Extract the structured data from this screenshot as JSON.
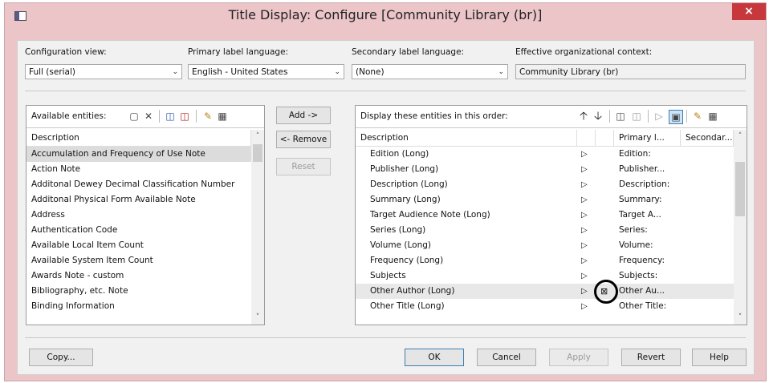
{
  "window": {
    "title": "Title Display: Configure [Community Library  (br)]",
    "close_glyph": "×",
    "accent_color": "#ecc5c9",
    "close_color": "#c7383c"
  },
  "config": {
    "configuration_view": {
      "label": "Configuration view:",
      "value": "Full (serial)"
    },
    "primary_language": {
      "label": "Primary label language:",
      "value": "English - United States"
    },
    "secondary_language": {
      "label": "Secondary label language:",
      "value": "(None)"
    },
    "context": {
      "label": "Effective organizational context:",
      "value": "Community Library  (br)"
    }
  },
  "available": {
    "toolbar_label": "Available entities:",
    "column_header": "Description",
    "items": [
      "Accumulation and Frequency of Use Note",
      "Action Note",
      "Additonal Dewey Decimal Classification Number",
      "Additonal Physical Form Available Note",
      "Address",
      "Authentication Code",
      "Available Local Item Count",
      "Available System Item Count",
      "Awards Note - custom",
      "Bibliography, etc. Note",
      "Binding Information"
    ],
    "selected_index": 0
  },
  "middle_buttons": {
    "add": "Add ->",
    "remove": "<- Remove",
    "reset": "Reset"
  },
  "display": {
    "toolbar_label": "Display these entities in this order:",
    "columns": {
      "description": "Description",
      "primary": "Primary l...",
      "secondary": "Secondar..."
    },
    "rows": [
      {
        "desc": "Edition (Long)",
        "primary": "Edition:"
      },
      {
        "desc": "Publisher (Long)",
        "primary": "Publisher..."
      },
      {
        "desc": "Description (Long)",
        "primary": "Description:"
      },
      {
        "desc": "Summary (Long)",
        "primary": "Summary:"
      },
      {
        "desc": "Target Audience Note (Long)",
        "primary": "Target A..."
      },
      {
        "desc": "Series (Long)",
        "primary": "Series:"
      },
      {
        "desc": "Volume (Long)",
        "primary": "Volume:"
      },
      {
        "desc": "Frequency (Long)",
        "primary": "Frequency:"
      },
      {
        "desc": "Subjects",
        "primary": "Subjects:"
      },
      {
        "desc": "Other Author (Long)",
        "primary": "Other Au..."
      },
      {
        "desc": "Other Title (Long)",
        "primary": "Other Title:"
      }
    ],
    "highlighted_index": 9
  },
  "footer": {
    "copy": "Copy...",
    "ok": "OK",
    "cancel": "Cancel",
    "apply": "Apply",
    "revert": "Revert",
    "help": "Help"
  }
}
